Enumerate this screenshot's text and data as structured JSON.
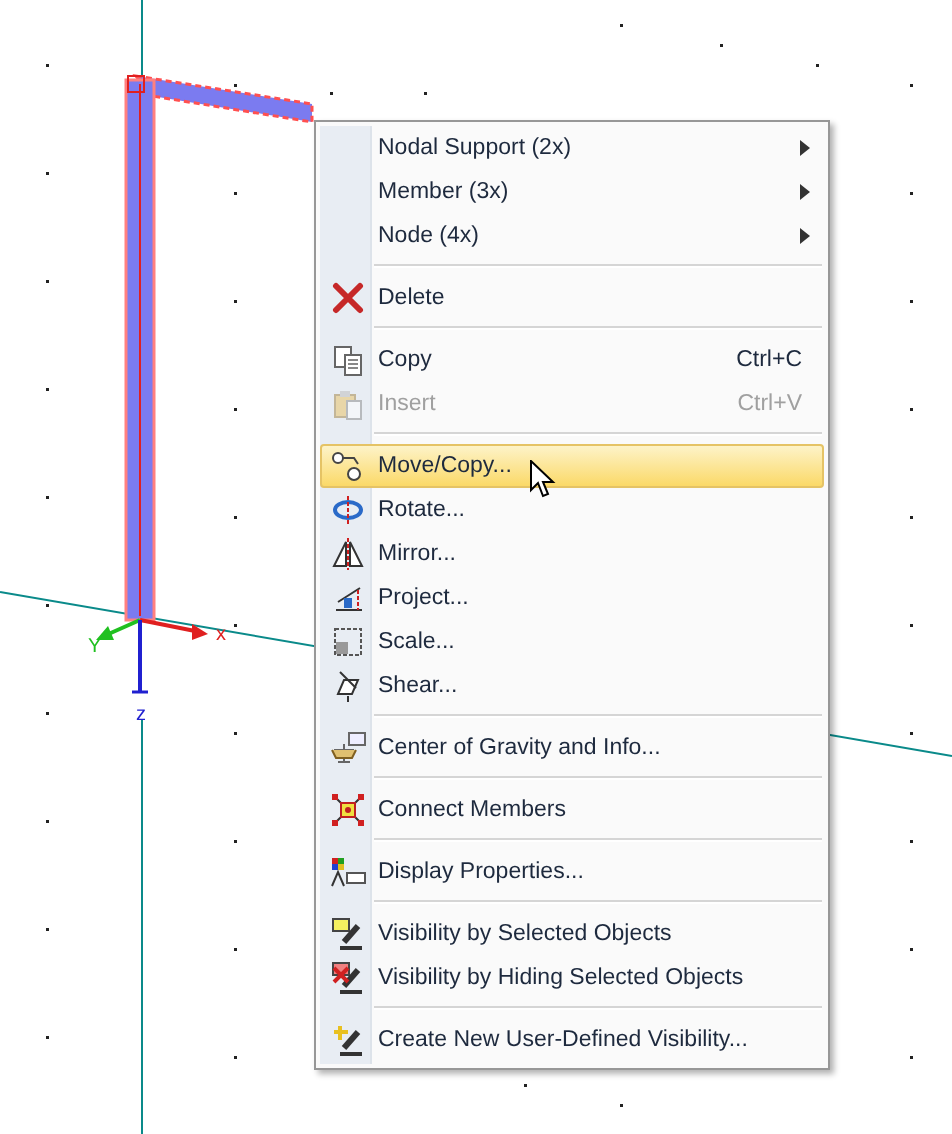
{
  "viewport": {
    "axes": [
      {
        "kind": "x",
        "label": "x"
      },
      {
        "kind": "y",
        "label": "Y"
      },
      {
        "kind": "z",
        "label": "z"
      }
    ]
  },
  "context_menu": {
    "items": [
      {
        "kind": "submenu",
        "label": "Nodal Support (2x)",
        "disabled": false,
        "selected": false
      },
      {
        "kind": "submenu",
        "label": "Member (3x)",
        "disabled": false,
        "selected": false
      },
      {
        "kind": "submenu",
        "label": "Node (4x)",
        "disabled": false,
        "selected": false
      },
      {
        "kind": "separator"
      },
      {
        "kind": "command",
        "label": "Delete",
        "disabled": false,
        "selected": false
      },
      {
        "kind": "separator"
      },
      {
        "kind": "command",
        "label": "Copy",
        "shortcut": "Ctrl+C",
        "disabled": false,
        "selected": false
      },
      {
        "kind": "command",
        "label": "Insert",
        "shortcut": "Ctrl+V",
        "disabled": true,
        "selected": false
      },
      {
        "kind": "separator"
      },
      {
        "kind": "command",
        "label": "Move/Copy...",
        "disabled": false,
        "selected": true
      },
      {
        "kind": "command",
        "label": "Rotate...",
        "disabled": false,
        "selected": false
      },
      {
        "kind": "command",
        "label": "Mirror...",
        "disabled": false,
        "selected": false
      },
      {
        "kind": "command",
        "label": "Project...",
        "disabled": false,
        "selected": false
      },
      {
        "kind": "command",
        "label": "Scale...",
        "disabled": false,
        "selected": false
      },
      {
        "kind": "command",
        "label": "Shear...",
        "disabled": false,
        "selected": false
      },
      {
        "kind": "separator"
      },
      {
        "kind": "command",
        "label": "Center of Gravity and Info...",
        "disabled": false,
        "selected": false
      },
      {
        "kind": "separator"
      },
      {
        "kind": "command",
        "label": "Connect Members",
        "disabled": false,
        "selected": false
      },
      {
        "kind": "separator"
      },
      {
        "kind": "command",
        "label": "Display Properties...",
        "disabled": false,
        "selected": false
      },
      {
        "kind": "separator"
      },
      {
        "kind": "command",
        "label": "Visibility by Selected Objects",
        "disabled": false,
        "selected": false
      },
      {
        "kind": "command",
        "label": "Visibility by Hiding Selected Objects",
        "disabled": false,
        "selected": false
      },
      {
        "kind": "separator"
      },
      {
        "kind": "command",
        "label": "Create New User-Defined Visibility...",
        "disabled": false,
        "selected": false
      }
    ]
  }
}
